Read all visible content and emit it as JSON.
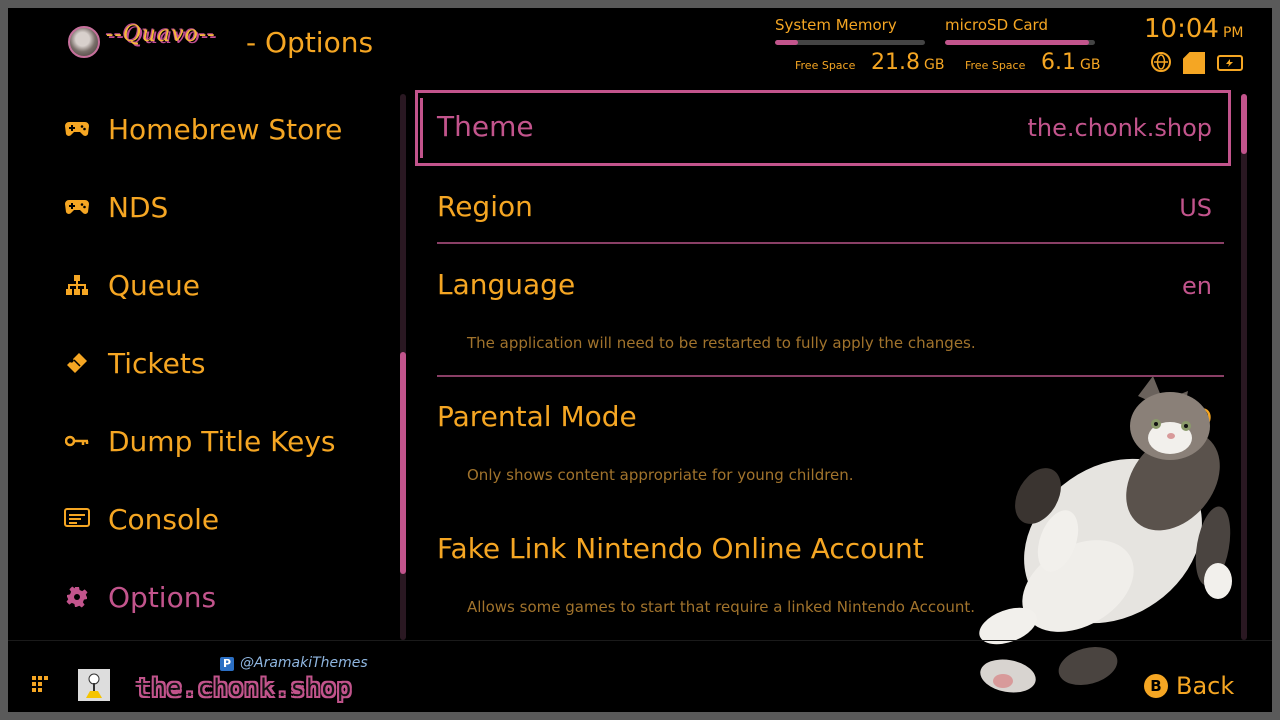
{
  "header": {
    "username": "--Quavo--",
    "page_title": "- Options",
    "storage": [
      {
        "label": "System Memory",
        "free_label": "Free Space",
        "value": "21.8",
        "unit": "GB",
        "used_fraction": 0.15
      },
      {
        "label": "microSD Card",
        "free_label": "Free Space",
        "value": "6.1",
        "unit": "GB",
        "used_fraction": 0.96
      }
    ],
    "time": "10:04",
    "ampm": "PM",
    "status_icons": [
      "globe-icon",
      "sd-card-icon",
      "battery-icon"
    ]
  },
  "sidebar": {
    "items": [
      {
        "label": "Homebrew Store",
        "icon": "gamepad-icon"
      },
      {
        "label": "NDS",
        "icon": "gamepad-icon"
      },
      {
        "label": "Queue",
        "icon": "hierarchy-icon"
      },
      {
        "label": "Tickets",
        "icon": "ticket-icon"
      },
      {
        "label": "Dump Title Keys",
        "icon": "key-icon"
      },
      {
        "label": "Console",
        "icon": "console-icon"
      },
      {
        "label": "Options",
        "icon": "gear-icon",
        "active": true
      }
    ]
  },
  "options": [
    {
      "name": "Theme",
      "value": "the.chonk.shop",
      "description": ""
    },
    {
      "name": "Region",
      "value": "US",
      "description": ""
    },
    {
      "name": "Language",
      "value": "en",
      "description": "The application will need to be restarted to fully apply the changes."
    },
    {
      "name": "Parental Mode",
      "value": "NO",
      "description": "Only shows content appropriate for young children."
    },
    {
      "name": "Fake Link Nintendo Online Account",
      "value": "",
      "description": "Allows some games to start that require a linked Nintendo Account."
    }
  ],
  "footer": {
    "handle": "@AramakiThemes",
    "brand": "the.chonk.shop",
    "back_button": "B",
    "back_label": "Back"
  },
  "colors": {
    "accent": "#f5a623",
    "highlight": "#c2548c",
    "background": "#000000"
  }
}
